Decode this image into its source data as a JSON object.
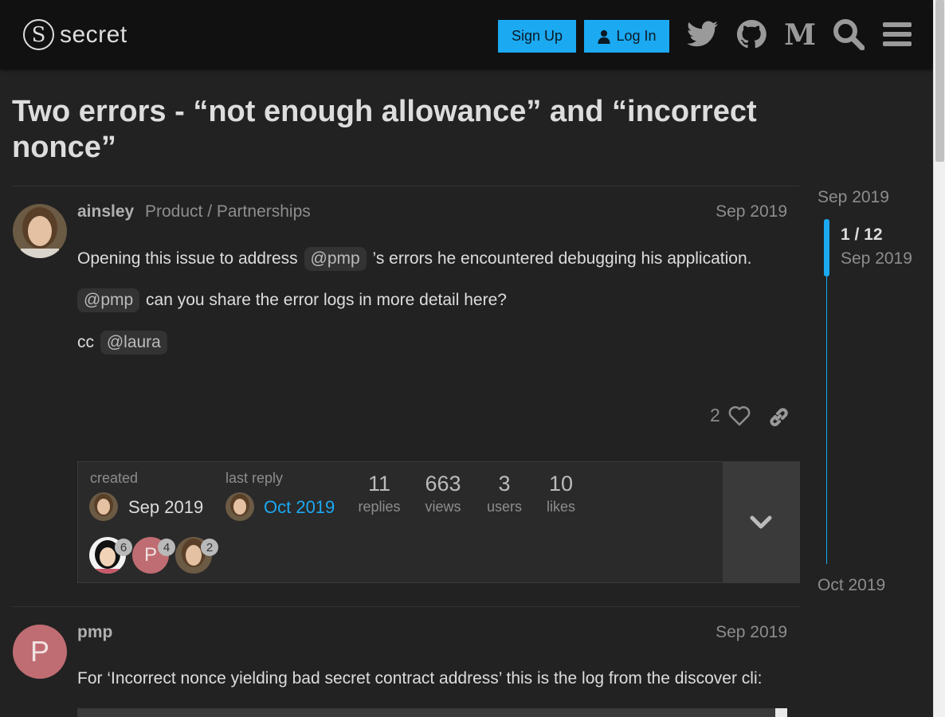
{
  "header": {
    "logo_text": "secret",
    "signup_label": "Sign Up",
    "login_label": "Log In",
    "icons": [
      "twitter-icon",
      "github-icon",
      "medium-icon",
      "search-icon",
      "hamburger-menu-icon"
    ],
    "accent_color": "#1ba9f2"
  },
  "topic": {
    "title": "Two errors - “not enough allowance” and “incorrect nonce”"
  },
  "post1": {
    "username": "ainsley",
    "user_title": "Product / Partnerships",
    "date": "Sep 2019",
    "line1_pre": "Opening this issue to address",
    "line1_mention": "@pmp",
    "line1_post": "’s errors he encountered debugging his application.",
    "line2_mention": "@pmp",
    "line2_post": "can you share the error logs in more detail here?",
    "line3_pre": "cc",
    "line3_mention": "@laura",
    "like_count": "2"
  },
  "topic_map": {
    "created_label": "created",
    "created_date": "Sep 2019",
    "last_reply_label": "last reply",
    "last_reply_date": "Oct 2019",
    "stats": [
      {
        "value": "11",
        "label": "replies"
      },
      {
        "value": "663",
        "label": "views"
      },
      {
        "value": "3",
        "label": "users"
      },
      {
        "value": "10",
        "label": "likes"
      }
    ],
    "participants": [
      {
        "count": "6"
      },
      {
        "letter": "P",
        "count": "4"
      },
      {
        "count": "2"
      }
    ]
  },
  "timeline": {
    "top_date": "Sep 2019",
    "position": "1 / 12",
    "position_date": "Sep 2019",
    "bottom_date": "Oct 2019"
  },
  "post2": {
    "username": "pmp",
    "avatar_letter": "P",
    "date": "Sep 2019",
    "text": "For ‘Incorrect nonce yielding bad secret contract address’ this is the log from the discover cli:"
  }
}
